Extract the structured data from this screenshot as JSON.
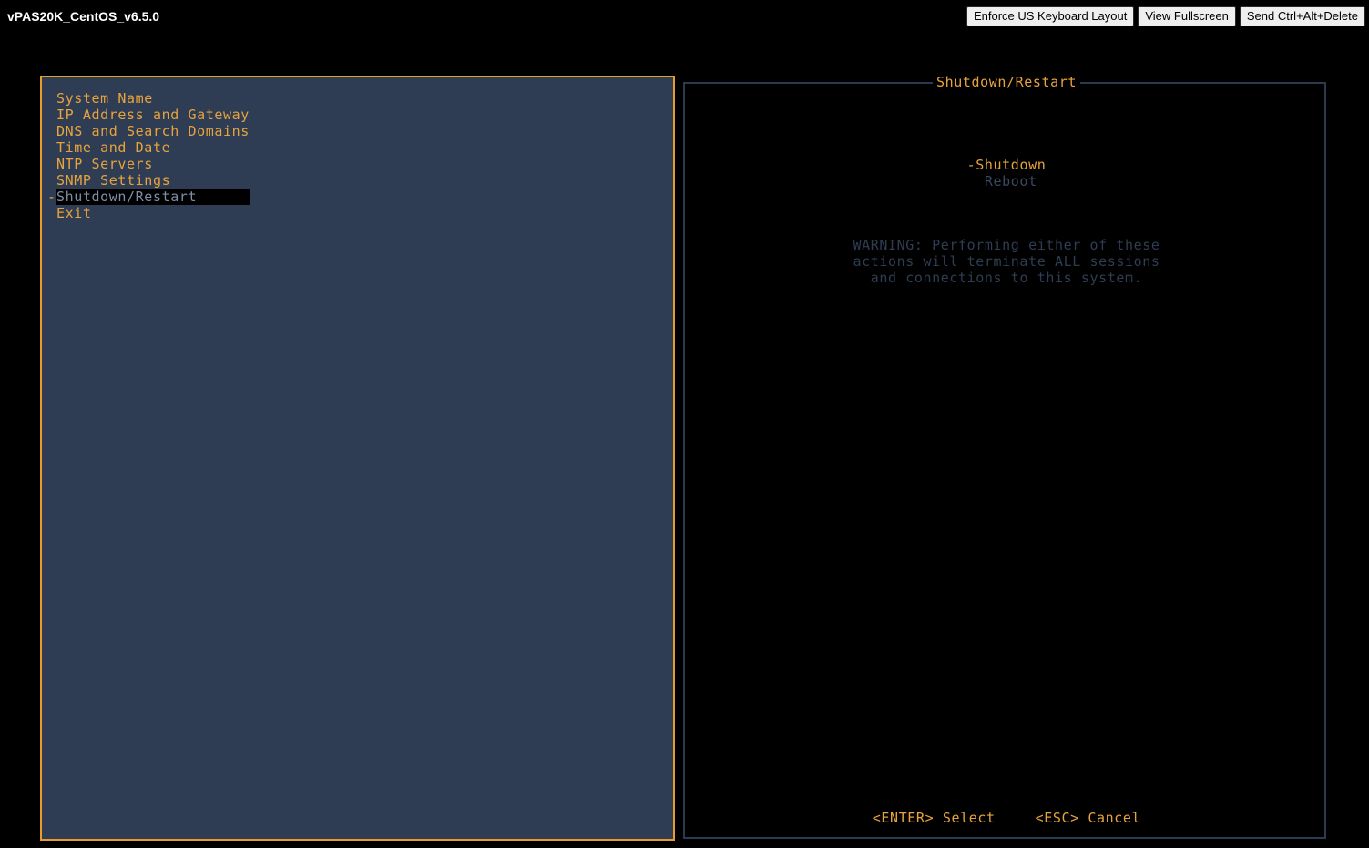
{
  "window": {
    "title": "vPAS20K_CentOS_v6.5.0"
  },
  "toolbar": {
    "buttons": [
      {
        "label": "Enforce US Keyboard Layout",
        "name": "enforce-us-keyboard-layout-button"
      },
      {
        "label": "View Fullscreen",
        "name": "view-fullscreen-button"
      },
      {
        "label": "Send Ctrl+Alt+Delete",
        "name": "send-ctrl-alt-delete-button"
      }
    ]
  },
  "colors": {
    "accent_orange": "#e8a33d",
    "panel_navy": "#2e3d54",
    "panel_border_blue": "#2b3a51",
    "dim_text": "#3b4a60",
    "warning_text": "#2f3d52",
    "highlight_bg": "#000000",
    "highlight_text": "#7d8fa6",
    "background": "#000000"
  },
  "left_menu": {
    "selection_marker": "-",
    "items": [
      {
        "label": "System Name",
        "selected": false
      },
      {
        "label": "IP Address and Gateway",
        "selected": false
      },
      {
        "label": "DNS and Search Domains",
        "selected": false
      },
      {
        "label": "Time and Date",
        "selected": false
      },
      {
        "label": "NTP Servers",
        "selected": false
      },
      {
        "label": "SNMP Settings",
        "selected": false
      },
      {
        "label": "Shutdown/Restart",
        "selected": true
      },
      {
        "label": "Exit",
        "selected": false
      }
    ]
  },
  "dialog": {
    "title": "Shutdown/Restart",
    "selection_marker": "-",
    "options": [
      {
        "label": "Shutdown",
        "selected": true
      },
      {
        "label": "Reboot",
        "selected": false
      }
    ],
    "warning_lines": [
      "WARNING: Performing either of these",
      "actions will terminate ALL sessions",
      "and connections to this system."
    ],
    "actions": [
      {
        "label": "<ENTER> Select",
        "name": "enter-select-action"
      },
      {
        "label": "<ESC> Cancel",
        "name": "esc-cancel-action"
      }
    ]
  }
}
